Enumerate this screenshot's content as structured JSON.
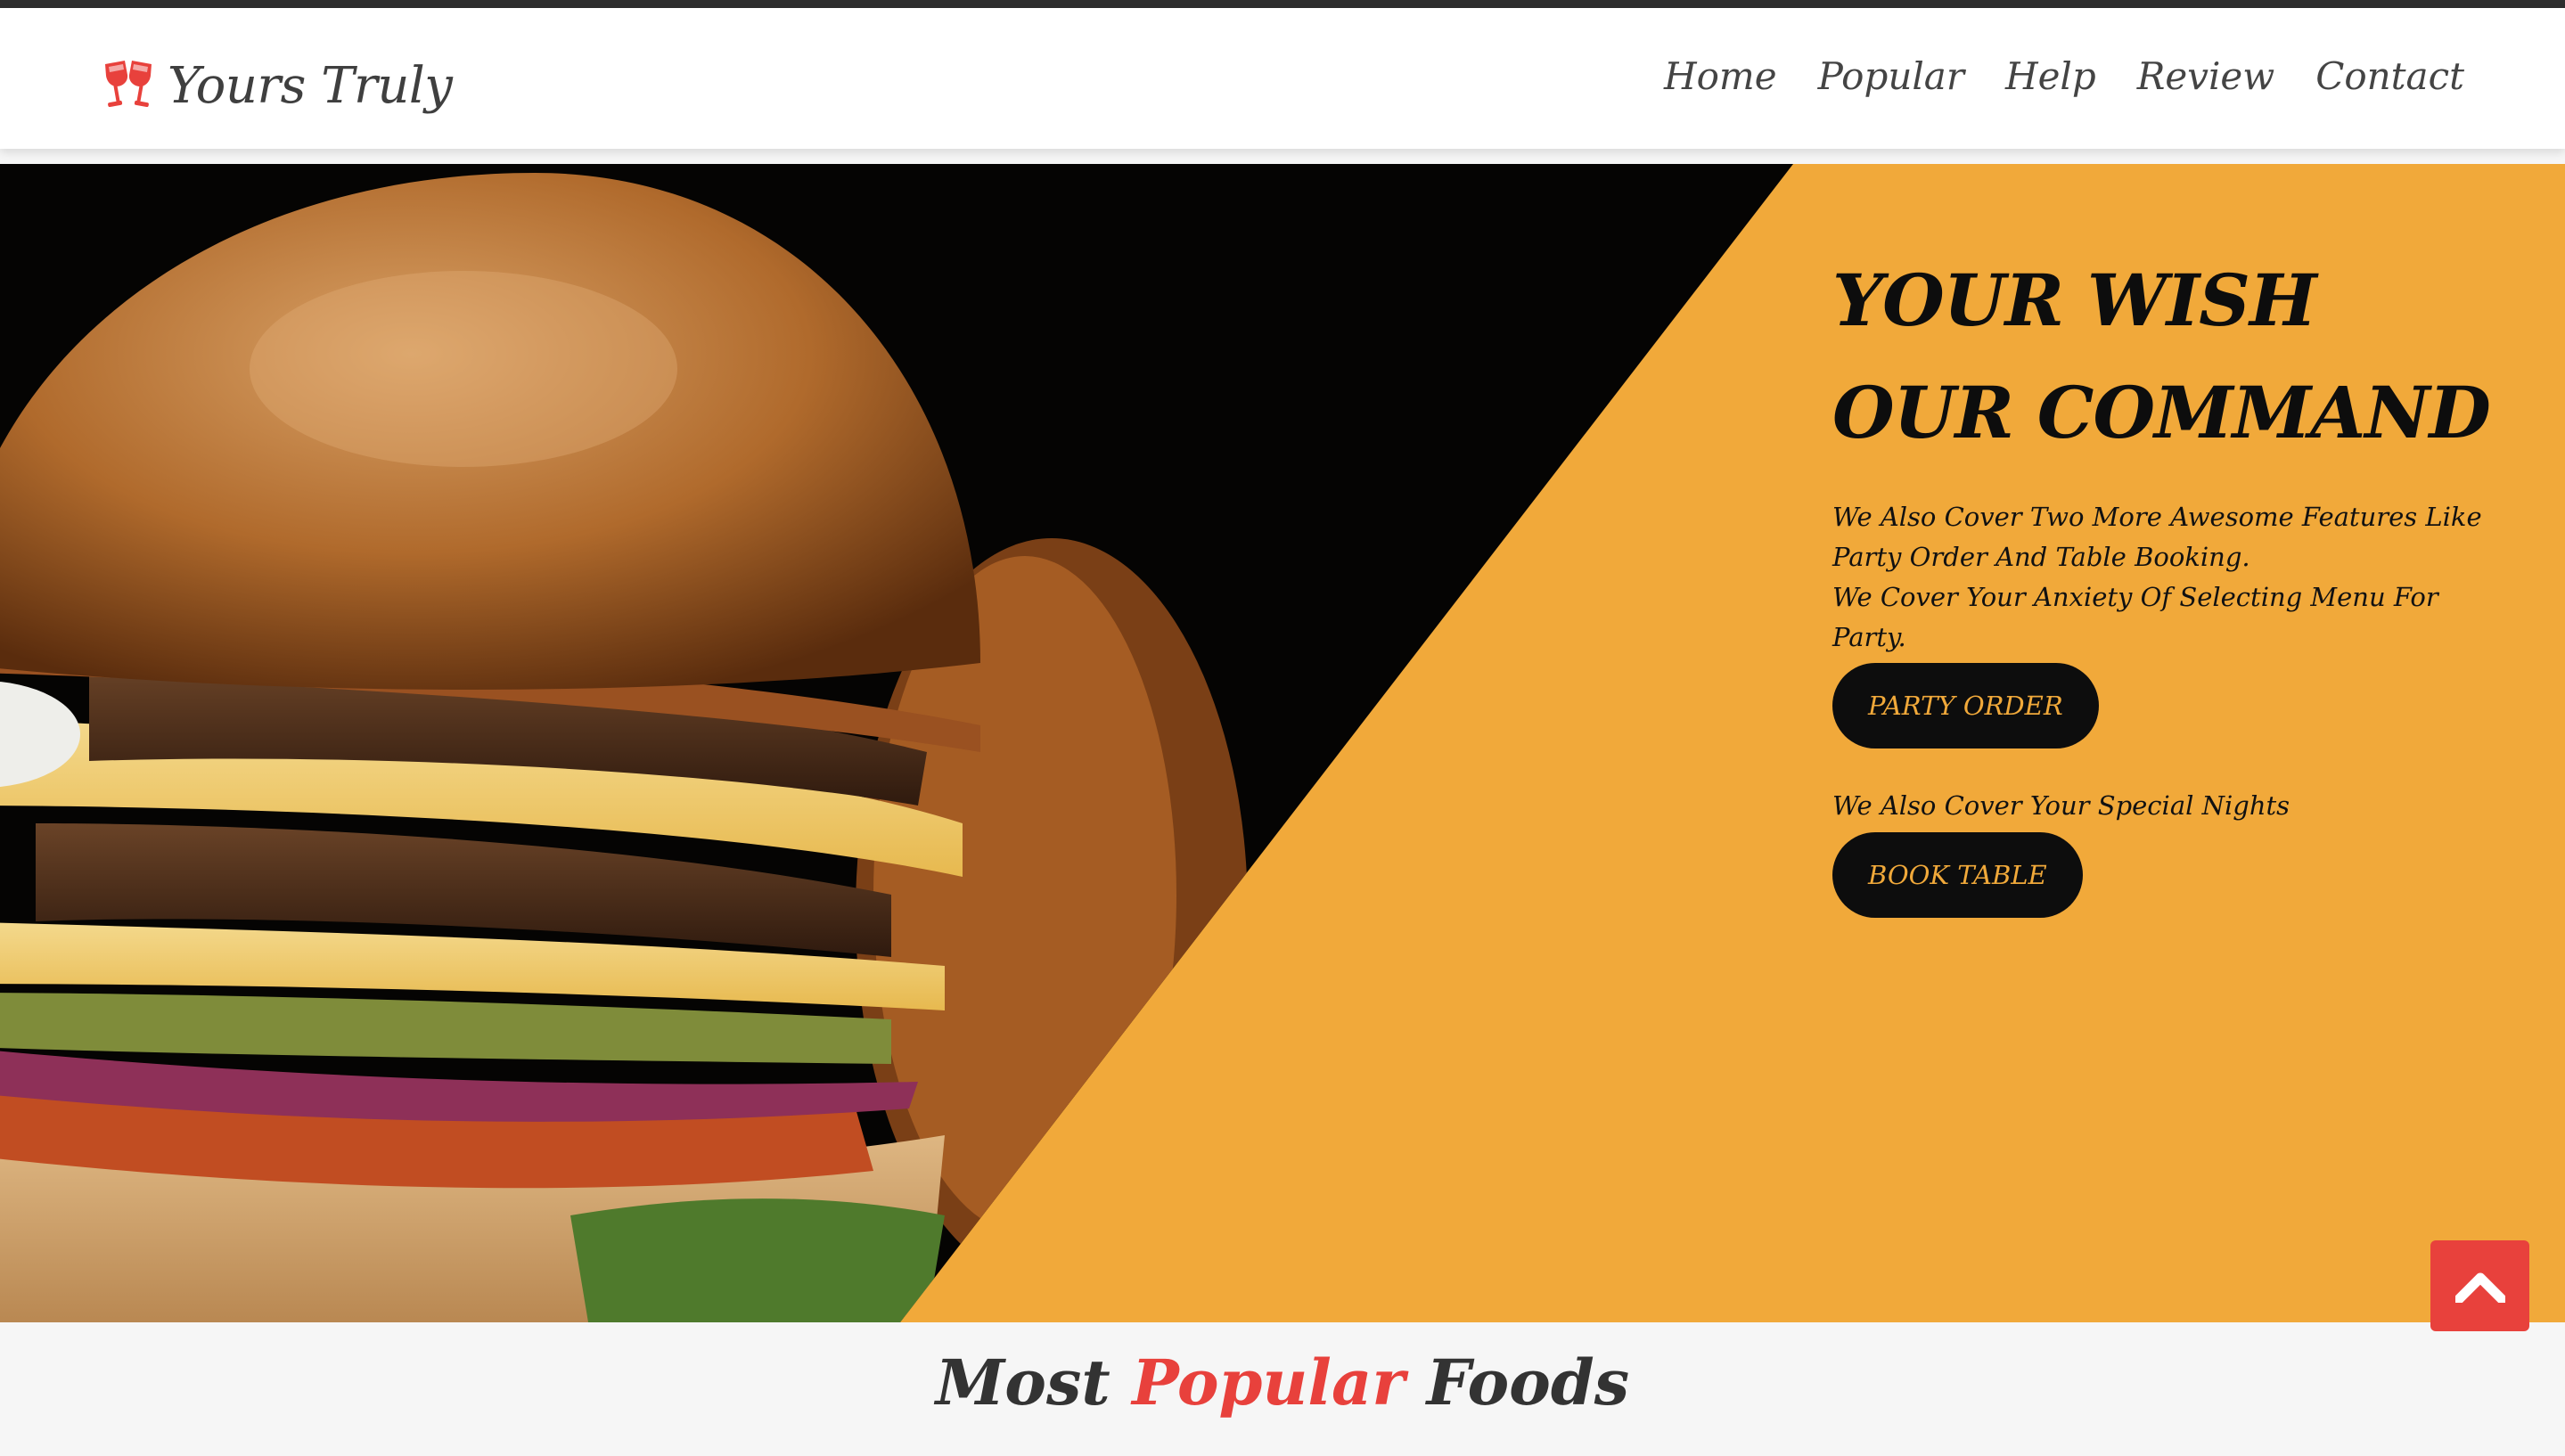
{
  "brand": {
    "name": "Yours Truly",
    "icon": "two-glasses-icon",
    "icon_color": "#e8413c"
  },
  "nav": {
    "items": [
      "Home",
      "Popular",
      "Help",
      "Review",
      "Contact"
    ]
  },
  "hero": {
    "image": "burger-photo",
    "background_color": "#f1a93a",
    "title_line1": "YOUR WISH",
    "title_line2": "OUR COMMAND",
    "desc_line1": "We Also Cover Two More Awesome Features Like Party Order And Table Booking.",
    "desc_line2": "We Cover Your Anxiety Of Selecting Menu For Party.",
    "party_button": "PARTY ORDER",
    "note": "We Also Cover Your Special Nights",
    "book_button": "BOOK TABLE"
  },
  "scroll_top": {
    "icon": "chevron-up-icon",
    "color": "#e8413c"
  },
  "section": {
    "title_part1": "Most",
    "title_accent": "Popular",
    "title_part2": "Foods"
  }
}
